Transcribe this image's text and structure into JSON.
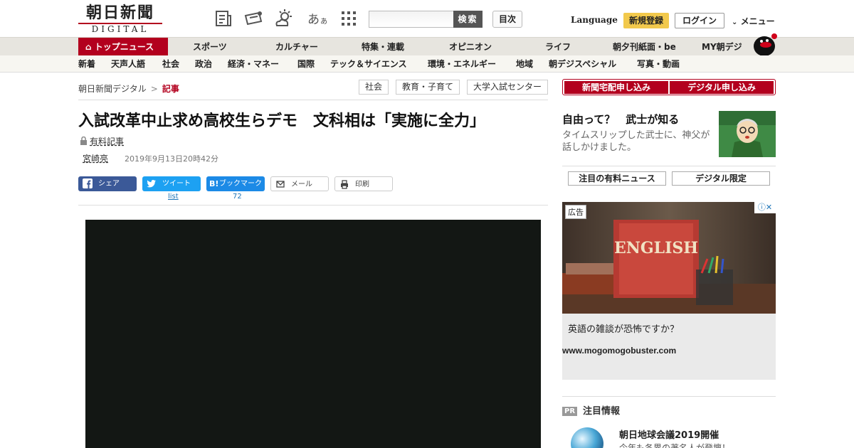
{
  "header": {
    "logo_jp": "朝日新聞",
    "logo_en": "DIGITAL",
    "search_button": "検索",
    "toc_button": "目次",
    "language": "Language",
    "register": "新規登録",
    "login": "ログイン",
    "menu": "メニュー",
    "icons": [
      "newspaper-icon",
      "ticket-icon",
      "weather-icon",
      "font-size-icon",
      "grid-icon"
    ]
  },
  "nav_main": [
    "トップニュース",
    "スポーツ",
    "カルチャー",
    "特集・連載",
    "オピニオン",
    "ライフ",
    "朝夕刊紙面・be",
    "MY朝デジ"
  ],
  "nav_sub": [
    "新着",
    "天声人語",
    "社会",
    "政治",
    "経済・マネー",
    "国際",
    "テック＆サイエンス",
    "環境・エネルギー",
    "地域",
    "朝デジスペシャル",
    "写真・動画"
  ],
  "breadcrumb": {
    "home": "朝日新聞デジタル",
    "current": "記事"
  },
  "tags": [
    "社会",
    "教育・子育て",
    "大学入試センター"
  ],
  "article": {
    "title": "入試改革中止求め高校生らデモ　文科相は「実施に全力」",
    "paid_label": "有料記事",
    "author": "宮崎亮",
    "date": "2019年9月13日20時42分"
  },
  "share": {
    "facebook": "シェア",
    "twitter": "ツイート",
    "twitter_sub": "list",
    "hatena": "ブックマーク",
    "hatena_count": "72",
    "mail": "メール",
    "print": "印刷"
  },
  "sidebar": {
    "subscribe_paper": "新聞宅配申し込み",
    "subscribe_digital": "デジタル申し込み",
    "promo_title": "自由って？　武士が知る",
    "promo_text": "タイムスリップした武士に、神父が話しかけました。",
    "tab_paid": "注目の有料ニュース",
    "tab_digital": "デジタル限定",
    "ad_label": "広告",
    "ad_book_text": "ENGLISH",
    "ad_headline": "英語の雑談が恐怖ですか？",
    "ad_url": "www.mogomogobuster.com",
    "pr_badge": "PR",
    "pr_heading": "注目情報",
    "pr_item_title": "朝日地球会議2019開催",
    "pr_item_sub": "今年も各界の著名人が登壇！"
  },
  "colors": {
    "brand_red": "#b3001e",
    "register_yellow": "#f2c94c",
    "facebook": "#3b5998",
    "twitter": "#1da1f2",
    "hatena": "#1c8ae6"
  }
}
